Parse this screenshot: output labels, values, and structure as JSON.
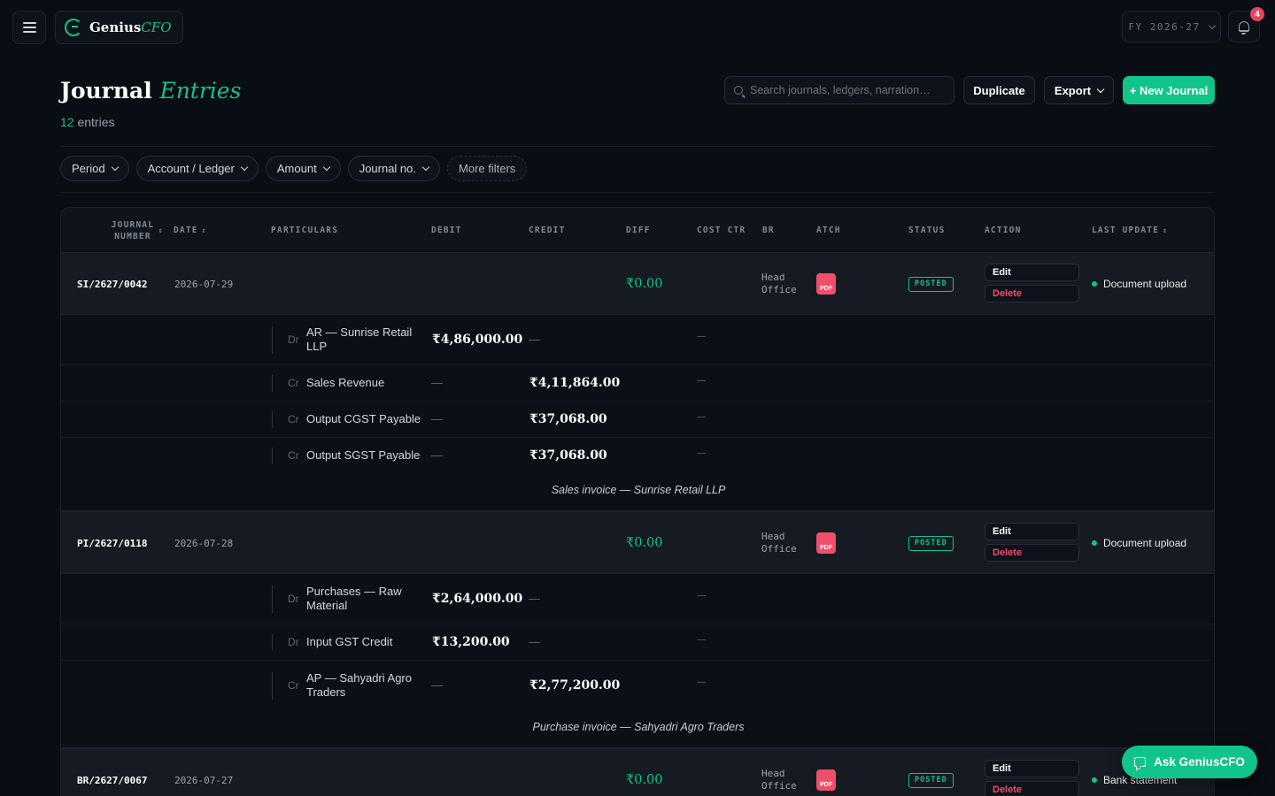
{
  "app": {
    "brand_main": "Genius",
    "brand_accent": "CFO",
    "accent_color": "#10c48a"
  },
  "topbar": {
    "fiscal_year": "FY 2026-27",
    "notification_count": "4"
  },
  "header": {
    "title_main": "Journal",
    "title_accent": "Entries",
    "entry_count": "12",
    "entry_label": "entries"
  },
  "search": {
    "placeholder": "Search journals, ledgers, narration…"
  },
  "actions": {
    "duplicate": "Duplicate",
    "export": "Export",
    "new_journal": "+ New Journal"
  },
  "filters": [
    "Period",
    "Account / Ledger",
    "Amount",
    "Journal no.",
    "More filters"
  ],
  "columns": {
    "journal_number": "JOURNAL NUMBER",
    "date": "DATE",
    "particulars": "PARTICULARS",
    "debit": "DEBIT",
    "credit": "CREDIT",
    "diff": "DIFF",
    "cost_ctr": "COST CTR",
    "br": "BR",
    "atch": "ATCH",
    "status": "STATUS",
    "action": "ACTION",
    "last_update": "LAST UPDATE",
    "sort_glyph": "⇕"
  },
  "row_labels": {
    "edit": "Edit",
    "delete": "Delete",
    "pdf": "PDF",
    "dash": "—"
  },
  "journals": [
    {
      "number": "SI/2627/0042",
      "date": "2026-07-29",
      "diff": "₹0.00",
      "branch": "Head Office",
      "status": "POSTED",
      "last_update": "Document upload",
      "lines": [
        {
          "side": "Dr",
          "account": "AR — Sunrise Retail LLP",
          "debit": "₹4,86,000.00",
          "credit": ""
        },
        {
          "side": "Cr",
          "account": "Sales Revenue",
          "debit": "",
          "credit": "₹4,11,864.00"
        },
        {
          "side": "Cr",
          "account": "Output CGST Payable",
          "debit": "",
          "credit": "₹37,068.00"
        },
        {
          "side": "Cr",
          "account": "Output SGST Payable",
          "debit": "",
          "credit": "₹37,068.00"
        }
      ],
      "narration": "Sales invoice — Sunrise Retail LLP"
    },
    {
      "number": "PI/2627/0118",
      "date": "2026-07-28",
      "diff": "₹0.00",
      "branch": "Head Office",
      "status": "POSTED",
      "last_update": "Document upload",
      "lines": [
        {
          "side": "Dr",
          "account": "Purchases — Raw Material",
          "debit": "₹2,64,000.00",
          "credit": ""
        },
        {
          "side": "Dr",
          "account": "Input GST Credit",
          "debit": "₹13,200.00",
          "credit": ""
        },
        {
          "side": "Cr",
          "account": "AP — Sahyadri Agro Traders",
          "debit": "",
          "credit": "₹2,77,200.00"
        }
      ],
      "narration": "Purchase invoice — Sahyadri Agro Traders"
    },
    {
      "number": "BR/2627/0067",
      "date": "2026-07-27",
      "diff": "₹0.00",
      "branch": "Head Office",
      "status": "POSTED",
      "last_update": "Bank statement",
      "lines": [],
      "narration": ""
    }
  ],
  "assistant": {
    "label": "Ask GeniusCFO"
  }
}
